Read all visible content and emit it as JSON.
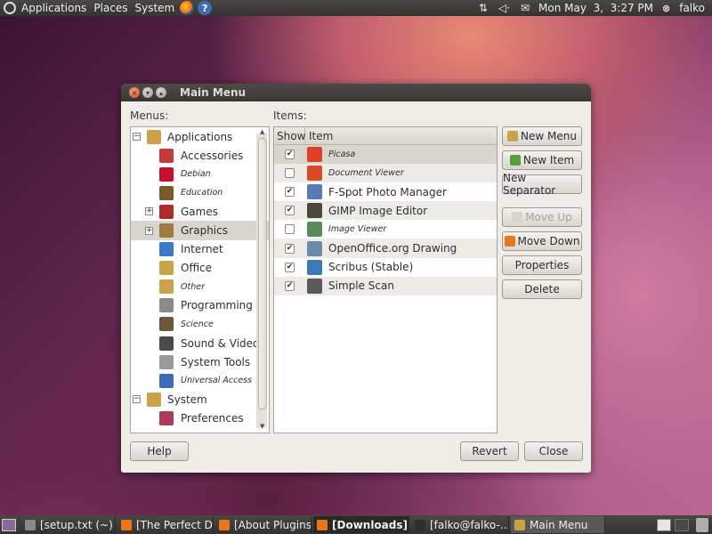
{
  "top_panel": {
    "menus": [
      "Applications",
      "Places",
      "System"
    ],
    "clock": "Mon May  3,  3:27 PM",
    "user": "falko"
  },
  "window": {
    "title": "Main Menu",
    "menus_label": "Menus:",
    "items_label": "Items:",
    "tree": [
      {
        "label": "Applications",
        "level": 0,
        "expander": "−",
        "italic": false,
        "icon": "applications-folder-icon",
        "color": "#c9a24a"
      },
      {
        "label": "Accessories",
        "level": 1,
        "italic": false,
        "icon": "accessories-icon",
        "color": "#c83a3a"
      },
      {
        "label": "Debian",
        "level": 1,
        "italic": true,
        "icon": "debian-icon",
        "color": "#c8102e"
      },
      {
        "label": "Education",
        "level": 1,
        "italic": true,
        "icon": "education-icon",
        "color": "#7a5a2a"
      },
      {
        "label": "Games",
        "level": 1,
        "expander": "+",
        "italic": false,
        "icon": "games-icon",
        "color": "#b02a2a"
      },
      {
        "label": "Graphics",
        "level": 1,
        "expander": "+",
        "italic": false,
        "selected": true,
        "icon": "graphics-icon",
        "color": "#a07a40"
      },
      {
        "label": "Internet",
        "level": 1,
        "italic": false,
        "icon": "internet-icon",
        "color": "#3a7ac8"
      },
      {
        "label": "Office",
        "level": 1,
        "italic": false,
        "icon": "office-icon",
        "color": "#c9a24a"
      },
      {
        "label": "Other",
        "level": 1,
        "italic": true,
        "icon": "other-folder-icon",
        "color": "#c9a24a"
      },
      {
        "label": "Programming",
        "level": 1,
        "italic": false,
        "icon": "programming-icon",
        "color": "#8a8a8a"
      },
      {
        "label": "Science",
        "level": 1,
        "italic": true,
        "icon": "science-icon",
        "color": "#6a5a3a"
      },
      {
        "label": "Sound & Video",
        "level": 1,
        "italic": false,
        "icon": "sound-video-icon",
        "color": "#4a4a4a"
      },
      {
        "label": "System Tools",
        "level": 1,
        "italic": false,
        "icon": "system-tools-icon",
        "color": "#9a9a9a"
      },
      {
        "label": "Universal Access",
        "level": 1,
        "italic": true,
        "icon": "universal-access-icon",
        "color": "#3a6ab8"
      },
      {
        "label": "System",
        "level": 0,
        "expander": "−",
        "italic": false,
        "icon": "system-folder-icon",
        "color": "#c9a24a"
      },
      {
        "label": "Preferences",
        "level": 1,
        "italic": false,
        "icon": "preferences-icon",
        "color": "#b03a5a"
      }
    ],
    "items_table": {
      "headers": {
        "show": "Show",
        "item": "Item"
      },
      "rows": [
        {
          "label": "Picasa",
          "checked": true,
          "italic": true,
          "selected": true,
          "icon": "picasa-icon",
          "color": "#e0402a"
        },
        {
          "label": "Document Viewer",
          "checked": false,
          "italic": true,
          "icon": "document-viewer-icon",
          "color": "#d84a2a"
        },
        {
          "label": "F-Spot Photo Manager",
          "checked": true,
          "italic": false,
          "icon": "fspot-icon",
          "color": "#5a7ab8"
        },
        {
          "label": "GIMP Image Editor",
          "checked": true,
          "italic": false,
          "icon": "gimp-icon",
          "color": "#4a4a3a"
        },
        {
          "label": "Image Viewer",
          "checked": false,
          "italic": true,
          "icon": "image-viewer-icon",
          "color": "#5a8a5a"
        },
        {
          "label": "OpenOffice.org Drawing",
          "checked": true,
          "italic": false,
          "icon": "ooo-drawing-icon",
          "color": "#6a8aa8"
        },
        {
          "label": "Scribus (Stable)",
          "checked": true,
          "italic": false,
          "icon": "scribus-icon",
          "color": "#3a7ab8"
        },
        {
          "label": "Simple Scan",
          "checked": true,
          "italic": false,
          "icon": "simple-scan-icon",
          "color": "#5a5a5a"
        }
      ]
    },
    "buttons": {
      "new_menu": "New Menu",
      "new_item": "New Item",
      "new_separator": "New Separator",
      "move_up": "Move Up",
      "move_down": "Move Down",
      "properties": "Properties",
      "delete": "Delete",
      "help": "Help",
      "revert": "Revert",
      "close": "Close"
    }
  },
  "taskbar": {
    "tasks": [
      {
        "label": "[setup.txt (~) ...",
        "icon": "text-editor-icon",
        "color": "#8a8a8a"
      },
      {
        "label": "[The Perfect D...",
        "icon": "firefox-icon",
        "color": "#e8761a"
      },
      {
        "label": "[About Plugins...",
        "icon": "firefox-icon",
        "color": "#e8761a"
      },
      {
        "label": "[Downloads]",
        "icon": "firefox-icon",
        "color": "#e8761a",
        "active": true
      },
      {
        "label": "[falko@falko-...",
        "icon": "terminal-icon",
        "color": "#2e2e2e"
      },
      {
        "label": "Main Menu",
        "icon": "main-menu-icon",
        "color": "#c9a24a",
        "current": true
      }
    ]
  }
}
